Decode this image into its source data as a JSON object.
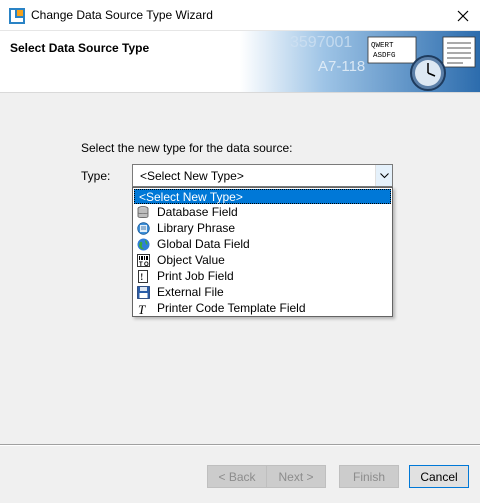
{
  "window": {
    "title": "Change Data Source Type Wizard",
    "app_icon": "bartender-logo-icon",
    "close_glyph": "✕"
  },
  "header": {
    "title": "Select Data Source Type",
    "banner_text": [
      "3597001",
      "A7-118",
      "QWERT",
      "ASDFG"
    ]
  },
  "main": {
    "prompt": "Select the new type for the data source:",
    "type_label": "Type:",
    "combo": {
      "value": "<Select New Type>"
    },
    "dropdown_items": [
      {
        "label": "<Select New Type>",
        "icon": "",
        "selected": true
      },
      {
        "label": "Database Field",
        "icon": "database-icon"
      },
      {
        "label": "Library Phrase",
        "icon": "library-phrase-icon"
      },
      {
        "label": "Global Data Field",
        "icon": "globe-icon"
      },
      {
        "label": "Object Value",
        "icon": "object-value-icon"
      },
      {
        "label": "Print Job Field",
        "icon": "print-job-icon"
      },
      {
        "label": "External File",
        "icon": "floppy-disk-icon"
      },
      {
        "label": "Printer Code Template Field",
        "icon": "template-field-icon"
      }
    ]
  },
  "footer": {
    "back_label": "< Back",
    "next_label": "Next >",
    "finish_label": "Finish",
    "cancel_label": "Cancel"
  },
  "colors": {
    "selection": "#0078d7",
    "dialog_bg": "#f0f0f0",
    "banner_blue": "#2f6fb0"
  }
}
